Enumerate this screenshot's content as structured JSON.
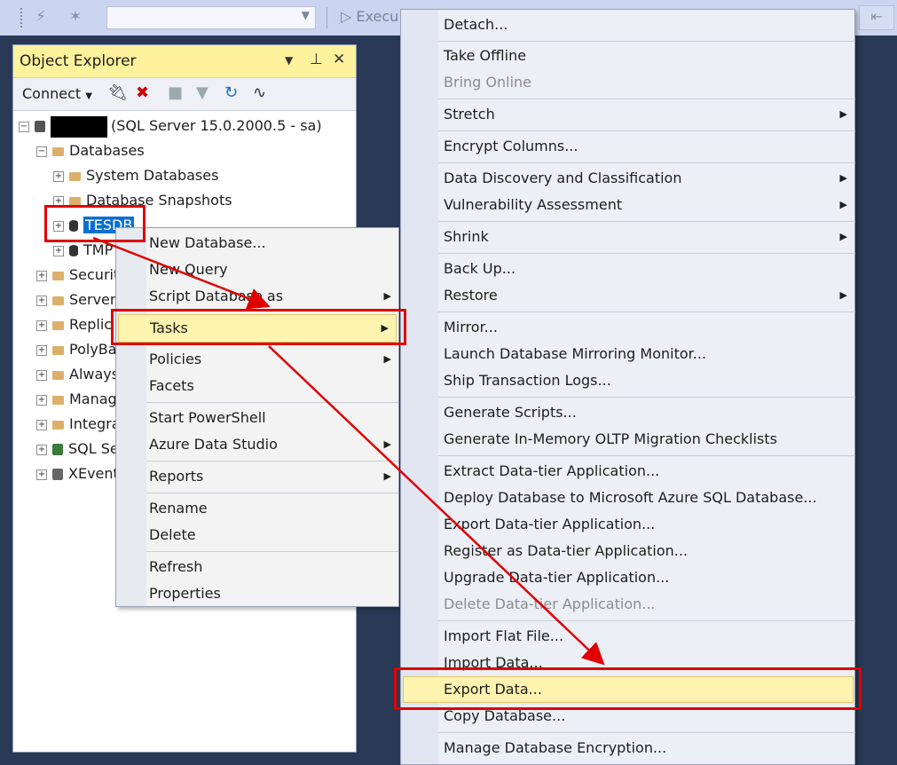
{
  "toolbar": {
    "execute_label": "Execu",
    "combo_value": ""
  },
  "object_explorer": {
    "title": "Object Explorer",
    "connect_label": "Connect",
    "tree": {
      "server": "(SQL Server 15.0.2000.5 - sa)",
      "databases": "Databases",
      "system_databases": "System Databases",
      "database_snapshots": "Database Snapshots",
      "selected_db": "TESDB",
      "tmp_db": "TMP",
      "security": "Securit",
      "server_objects": "Server",
      "replication": "Replic",
      "polybase": "PolyBa",
      "always_on": "Always",
      "management": "Manag",
      "integration": "Integra",
      "sql_agent": "SQL Se",
      "xevent": "XEvent"
    }
  },
  "context_menu": {
    "new_database": "New Database...",
    "new_query": "New Query",
    "script_database_as": "Script Database as",
    "tasks": "Tasks",
    "policies": "Policies",
    "facets": "Facets",
    "start_powershell": "Start PowerShell",
    "azure_data_studio": "Azure Data Studio",
    "reports": "Reports",
    "rename": "Rename",
    "delete": "Delete",
    "refresh": "Refresh",
    "properties": "Properties"
  },
  "tasks_menu": {
    "detach": "Detach...",
    "take_offline": "Take Offline",
    "bring_online": "Bring Online",
    "stretch": "Stretch",
    "encrypt_columns": "Encrypt Columns...",
    "data_discovery": "Data Discovery and Classification",
    "vulnerability": "Vulnerability Assessment",
    "shrink": "Shrink",
    "back_up": "Back Up...",
    "restore": "Restore",
    "mirror": "Mirror...",
    "launch_mirroring": "Launch Database Mirroring Monitor...",
    "ship_logs": "Ship Transaction Logs...",
    "generate_scripts": "Generate Scripts...",
    "generate_inmemory": "Generate In-Memory OLTP Migration Checklists",
    "extract_dac": "Extract Data-tier Application...",
    "deploy_azure": "Deploy Database to Microsoft Azure SQL Database...",
    "export_dac": "Export Data-tier Application...",
    "register_dac": "Register as Data-tier Application...",
    "upgrade_dac": "Upgrade Data-tier Application...",
    "delete_dac": "Delete Data-tier Application...",
    "import_flat_file": "Import Flat File...",
    "import_data": "Import Data...",
    "export_data": "Export Data...",
    "copy_database": "Copy Database...",
    "manage_encryption": "Manage Database Encryption..."
  },
  "colors": {
    "highlight": "#fff3b0",
    "annotation_red": "#e00000",
    "selection_blue": "#0a6fd0"
  }
}
